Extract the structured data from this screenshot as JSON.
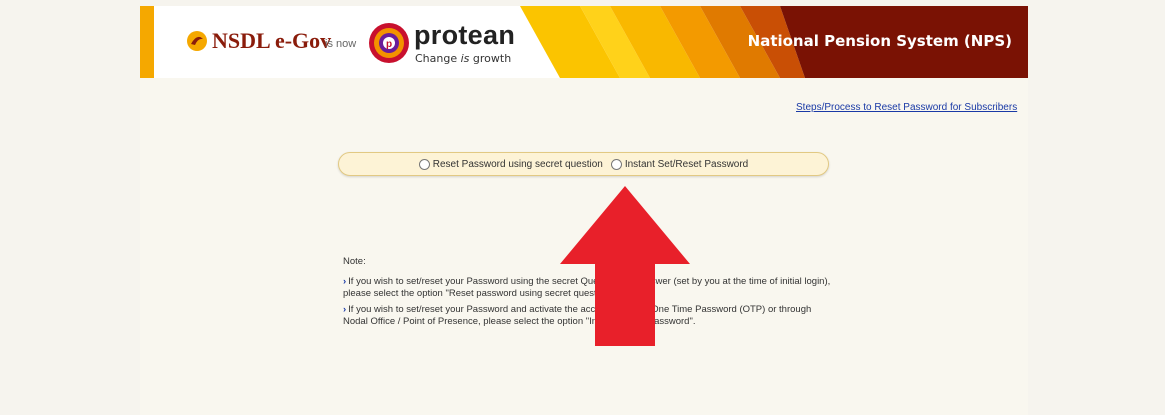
{
  "header": {
    "brand_old": "NSDL e-Gov",
    "is_now": "is now",
    "brand_new": "protean",
    "tagline_prefix": "Change",
    "tagline_italic": "is",
    "tagline_suffix": "growth",
    "system_title": "National Pension System (NPS)"
  },
  "links": {
    "steps": "Steps/Process to Reset Password for Subscribers"
  },
  "options": {
    "secret_question": "Reset Password using secret question",
    "instant": "Instant Set/Reset Password"
  },
  "note": {
    "title": "Note:",
    "item1": "If you wish to set/reset your Password using the secret Question and Answer (set by you at the time of initial login), please select the option \"Reset password using secret question\".",
    "item2": "If you wish to set/reset your Password and activate the account through One Time Password (OTP) or through Nodal Office / Point of Presence, please select the option \"Instant Reset Password\"."
  },
  "colors": {
    "header_dark": "#7a1204",
    "orange": "#f5a800",
    "arrow": "#e8202a"
  }
}
